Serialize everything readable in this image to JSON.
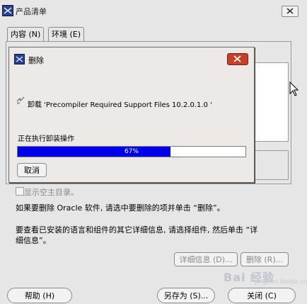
{
  "main_window": {
    "title": "产品清单",
    "tabs": [
      {
        "label": "内容 (N)"
      },
      {
        "label": "环境 (E)"
      }
    ],
    "show_empty_dirs_label": "显示空主目录。",
    "info_line_1": "如果要删除 Oracle 软件, 请选中要删除的项并单击 “删除”。",
    "info_line_2": "要查看已安装的语言和组件的其它详细信息, 请选择组件, 然后单击 “详",
    "info_line_3": "细信息”。",
    "details_button": "详细信息 (D)...",
    "remove_button": "删除 (R)...",
    "help_button": "帮助 (H)",
    "save_as_button": "另存为 (S)...",
    "close_button": "关闭 (C)"
  },
  "dialog": {
    "title": "删除",
    "uninstall_message": "卸载 'Precompiler Required Support Files 10.2.0.1.0 '",
    "operation_label": "正在执行卸装操作",
    "progress_text": "67%",
    "progress_value": 0.67,
    "cancel_button": "取消"
  },
  "watermark": {
    "text": "Bai 经验",
    "sub": "jingyan.baidu.com"
  },
  "colors": {
    "progress_fill": "#0000e8",
    "dialog_close": "#c4402a",
    "app_icon": "#2a3f8a"
  }
}
